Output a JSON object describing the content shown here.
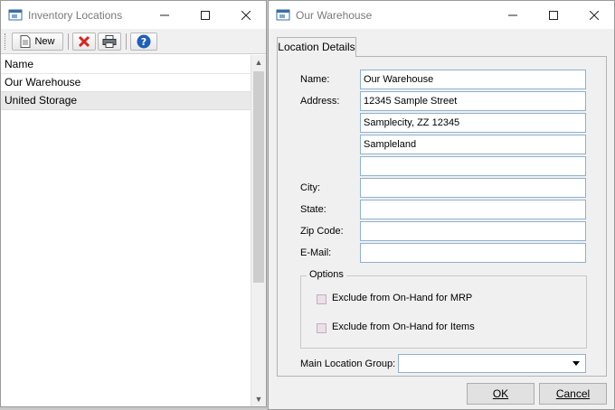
{
  "left_window": {
    "title": "Inventory Locations",
    "toolbar": {
      "new_label": "New"
    },
    "list": {
      "header": "Name",
      "rows": [
        "Our Warehouse",
        "United Storage"
      ]
    }
  },
  "right_window": {
    "title": "Our Warehouse",
    "tab": "Location Details",
    "fields": {
      "name_label": "Name:",
      "name_value": "Our Warehouse",
      "address_label": "Address:",
      "address_lines": [
        "12345 Sample Street",
        "Samplecity, ZZ 12345",
        "Sampleland",
        ""
      ],
      "city_label": "City:",
      "city_value": "",
      "state_label": "State:",
      "state_value": "",
      "zip_label": "Zip Code:",
      "zip_value": "",
      "email_label": "E-Mail:",
      "email_value": ""
    },
    "options": {
      "legend": "Options",
      "exclude_mrp": "Exclude from On-Hand for MRP",
      "exclude_items": "Exclude from On-Hand for Items"
    },
    "main_location_group": {
      "label": "Main Location Group:",
      "value": ""
    },
    "ok_label": "OK",
    "cancel_label": "Cancel"
  },
  "colors": {
    "field_border": "#8fb1cf",
    "delete_red": "#d9261c",
    "help_blue": "#1f5fb8"
  },
  "icons": [
    "app-icon",
    "minimize-icon",
    "maximize-icon",
    "close-icon",
    "new-document-icon",
    "delete-icon",
    "print-icon",
    "help-icon"
  ]
}
